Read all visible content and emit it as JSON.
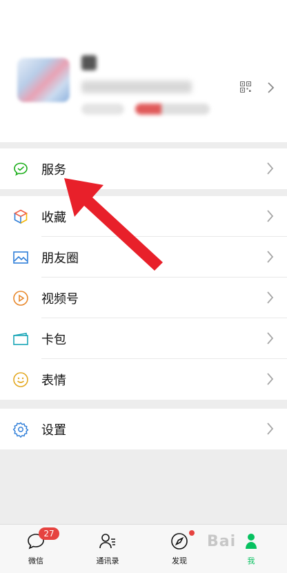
{
  "profile": {},
  "menu_groups": [
    {
      "items": [
        {
          "key": "services",
          "label": "服务",
          "icon": "wechat-pay-icon"
        }
      ]
    },
    {
      "items": [
        {
          "key": "favorites",
          "label": "收藏",
          "icon": "cube-icon"
        },
        {
          "key": "moments",
          "label": "朋友圈",
          "icon": "image-icon"
        },
        {
          "key": "channels",
          "label": "视频号",
          "icon": "play-circle-icon"
        },
        {
          "key": "cards",
          "label": "卡包",
          "icon": "wallet-icon"
        },
        {
          "key": "stickers",
          "label": "表情",
          "icon": "smiley-icon"
        }
      ]
    },
    {
      "items": [
        {
          "key": "settings",
          "label": "设置",
          "icon": "gear-icon"
        }
      ]
    }
  ],
  "tabbar": {
    "chats": {
      "label": "微信",
      "badge": "27"
    },
    "contacts": {
      "label": "通讯录"
    },
    "discover": {
      "label": "发现"
    },
    "me": {
      "label": "我"
    }
  },
  "watermark": "Bai",
  "colors": {
    "accent": "#07c160",
    "badge": "#e64340",
    "annotation_arrow": "#e8202a"
  }
}
